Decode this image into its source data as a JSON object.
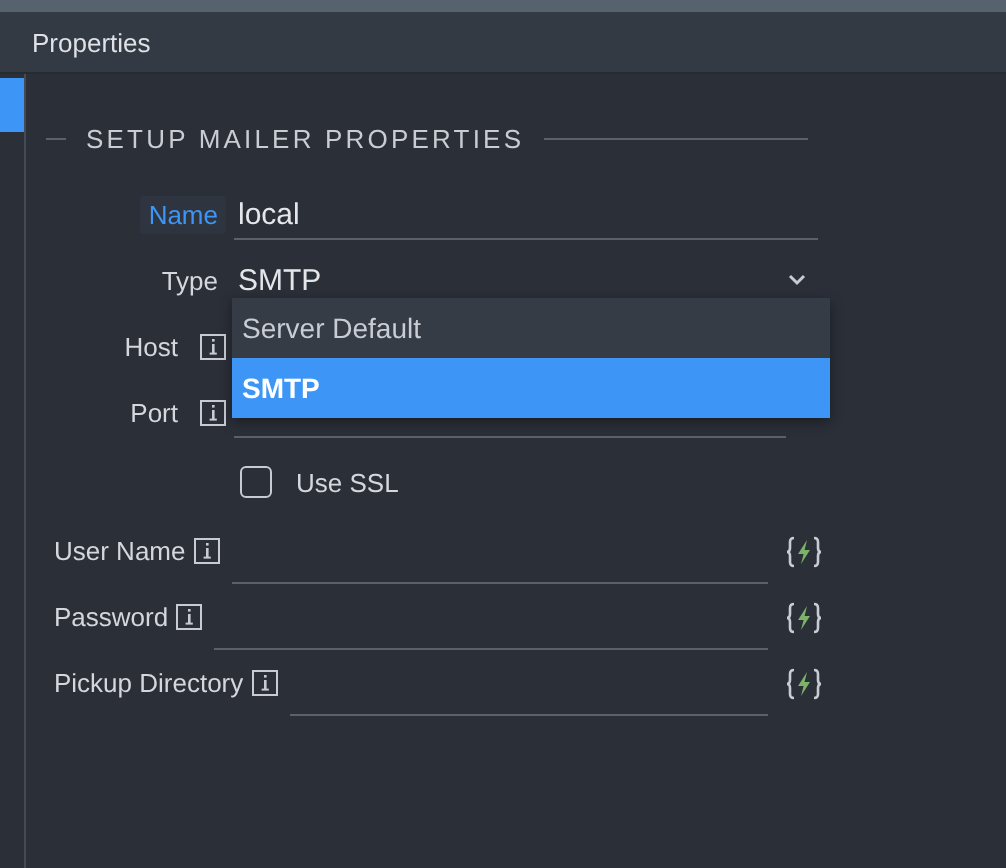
{
  "panel": {
    "title": "Properties"
  },
  "section": {
    "title": "SETUP MAILER PROPERTIES"
  },
  "fields": [
    {
      "kind": "text",
      "label": "Name",
      "value": "local",
      "focused": true,
      "info": false
    },
    {
      "kind": "select",
      "label": "Type",
      "value": "SMTP",
      "focused": false,
      "info": false,
      "expanded": true,
      "options": [
        {
          "label": "Server Default",
          "selected": false
        },
        {
          "label": "SMTP",
          "selected": true
        }
      ]
    },
    {
      "kind": "bare",
      "label": "Host",
      "focused": false,
      "info": true
    },
    {
      "kind": "text",
      "label": "Port",
      "focused": false,
      "info": true
    },
    {
      "kind": "checkbox",
      "label": "Use SSL",
      "checked": false
    }
  ],
  "credentials": [
    {
      "label": "User Name",
      "info": true,
      "dynamic": true
    },
    {
      "label": "Password",
      "info": true,
      "dynamic": true
    },
    {
      "label": "Pickup Directory",
      "info": true,
      "dynamic": true
    }
  ]
}
